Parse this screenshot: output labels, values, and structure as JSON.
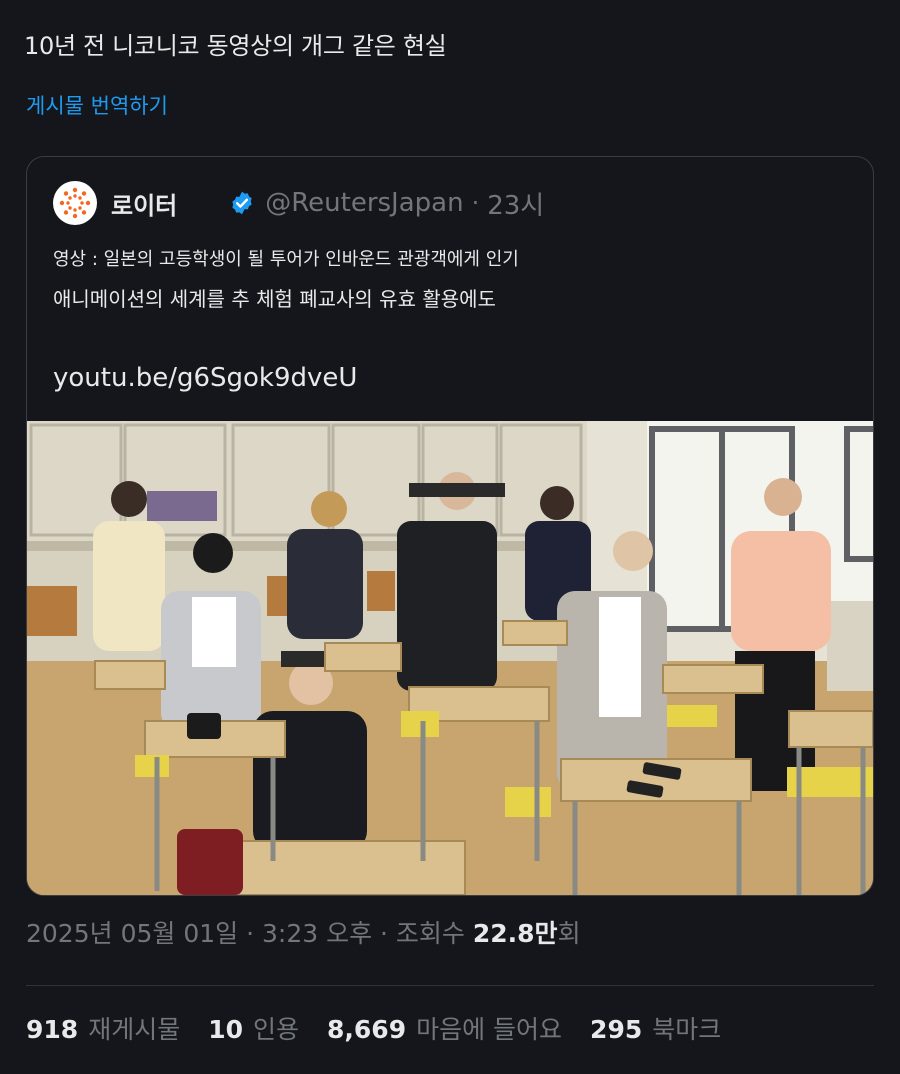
{
  "tweet": {
    "text": "10년 전 니코니코 동영상의 개그 같은 현실",
    "translate_label": "게시물 번역하기"
  },
  "quote": {
    "author_name": "로이터",
    "handle": "@ReutersJapan",
    "separator": "·",
    "time_ago": "23시",
    "line1": "영상 : 일본의 고등학생이 될 투어가 인바운드 관광객에게 인기",
    "line2": "애니메이션의 세계를 추 체험 폐교사의 유효 활용에도",
    "link": "youtu.be/g6Sgok9dveU"
  },
  "meta": {
    "date": "2025년 05월 01일",
    "sep1": " · ",
    "time": "3:23 오후",
    "sep2": " · ",
    "views_label": "조회수 ",
    "views_value": "22.8만",
    "views_suffix": "회"
  },
  "stats": [
    {
      "num": "918",
      "label": "재게시물"
    },
    {
      "num": "10",
      "label": "인용"
    },
    {
      "num": "8,669",
      "label": "마음에 들어요"
    },
    {
      "num": "295",
      "label": "북마크"
    }
  ],
  "colors": {
    "background": "#15161b",
    "link": "#1d9bf0",
    "muted": "#71767b",
    "verified": "#1d9bf0"
  }
}
